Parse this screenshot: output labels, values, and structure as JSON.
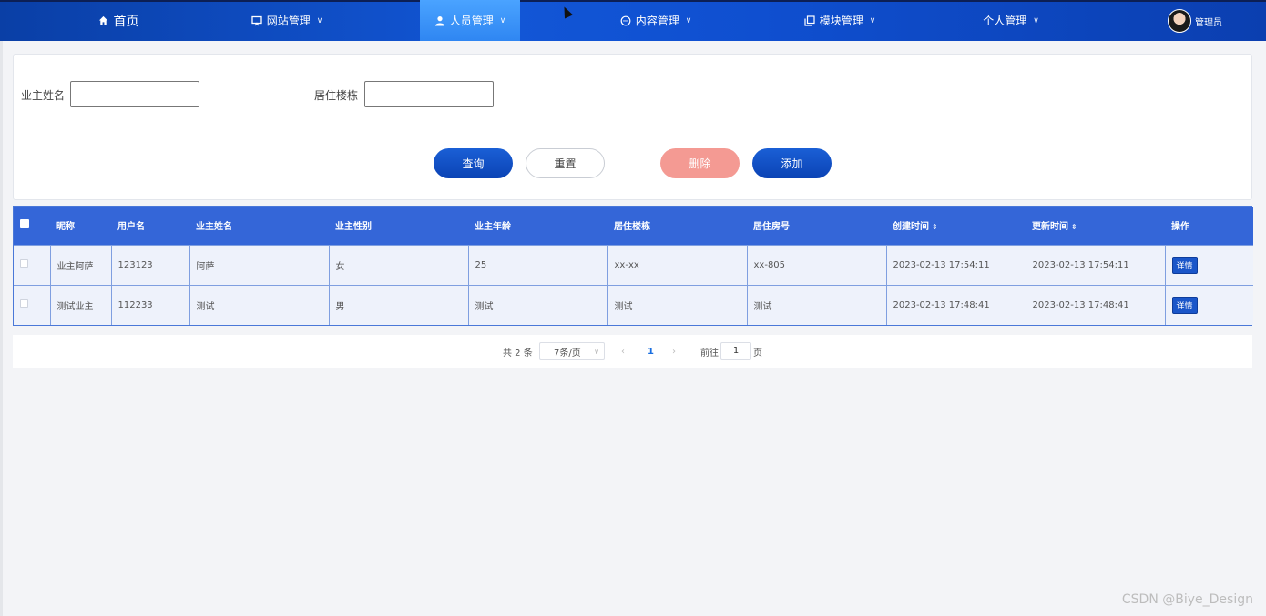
{
  "nav": {
    "items": [
      {
        "label": "首页",
        "icon": "home-icon"
      },
      {
        "label": "网站管理",
        "icon": "monitor-icon"
      },
      {
        "label": "人员管理",
        "icon": "user-icon"
      },
      {
        "label": "内容管理",
        "icon": "chat-icon"
      },
      {
        "label": "模块管理",
        "icon": "copy-icon"
      },
      {
        "label": "个人管理",
        "icon": ""
      }
    ],
    "active_index": 2,
    "user_label": "管理员"
  },
  "search": {
    "owner_name_label": "业主姓名",
    "owner_name_value": "",
    "building_label": "居住楼栋",
    "building_value": "",
    "query_label": "查询",
    "reset_label": "重置",
    "delete_label": "删除",
    "add_label": "添加"
  },
  "table": {
    "headers": [
      "昵称",
      "用户名",
      "业主姓名",
      "业主性别",
      "业主年龄",
      "居住楼栋",
      "居住房号",
      "创建时间",
      "更新时间",
      "操作"
    ],
    "sortable": [
      "创建时间",
      "更新时间"
    ],
    "rows": [
      [
        "业主阿萨",
        "123123",
        "阿萨",
        "女",
        "25",
        "xx-xx",
        "xx-805",
        "2023-02-13 17:54:11",
        "2023-02-13 17:54:11",
        "详情"
      ],
      [
        "测试业主",
        "112233",
        "测试",
        "男",
        "测试",
        "测试",
        "测试",
        "2023-02-13 17:48:41",
        "2023-02-13 17:48:41",
        "详情"
      ]
    ]
  },
  "pagination": {
    "total_text": "共 2 条",
    "page_size": "7条/页",
    "prev": "‹",
    "current_page": "1",
    "next": "›",
    "goto_label": "前往",
    "goto_value": "1",
    "page_suffix": "页"
  },
  "watermark": "CSDN @Biye_Design",
  "colors": {
    "nav_bg": "#1256d6",
    "active_nav": "#3b8ff5",
    "primary": "#0b43b5",
    "delete": "#f49a93",
    "table_header": "#3466d8"
  }
}
